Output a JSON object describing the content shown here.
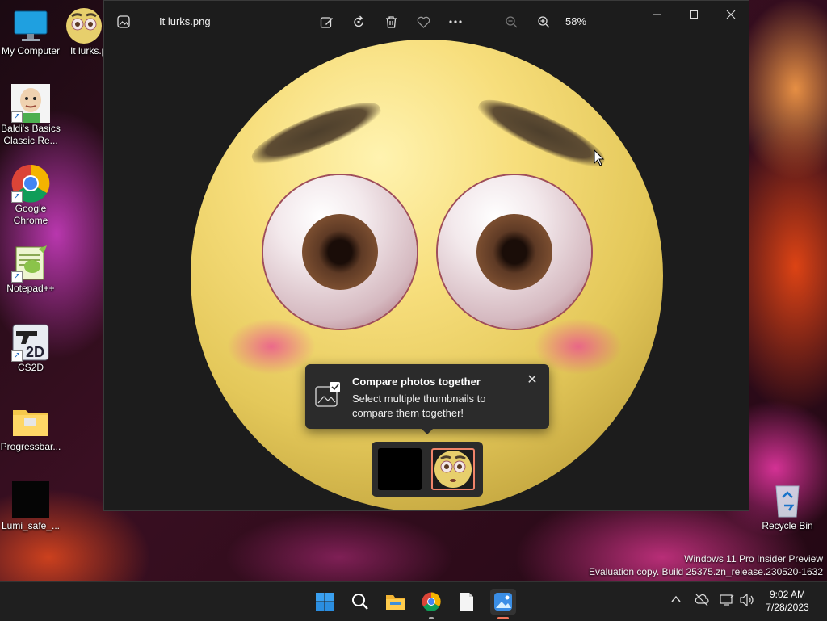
{
  "desktop": {
    "icons": [
      {
        "label": "My Computer",
        "icon": "monitor-icon"
      },
      {
        "label": "It lurks.p",
        "icon": "image-file-icon"
      },
      {
        "label": "Baldi's Basics Classic Re...",
        "icon": "baldi-app-icon"
      },
      {
        "label": "Google Chrome",
        "icon": "chrome-icon"
      },
      {
        "label": "Notepad++",
        "icon": "notepadpp-icon"
      },
      {
        "label": "CS2D",
        "icon": "cs2d-icon"
      },
      {
        "label": "Progressbar...",
        "icon": "folder-icon"
      },
      {
        "label": "Lumi_safe_...",
        "icon": "black-file-icon"
      },
      {
        "label": "Recycle Bin",
        "icon": "recycle-bin-icon"
      }
    ]
  },
  "photos_window": {
    "filename": "It lurks.png",
    "zoom": "58%",
    "toolbar": [
      "edit-image-icon",
      "rotate-icon",
      "delete-icon",
      "favorite-icon",
      "more-options-icon"
    ],
    "window_controls": [
      "minimize-icon",
      "maximize-icon",
      "close-icon"
    ],
    "toast": {
      "title": "Compare photos together",
      "body": "Select multiple thumbnails to compare them together!"
    },
    "filmstrip_selected_index": 1
  },
  "watermark": {
    "line1": "Windows 11 Pro Insider Preview",
    "line2": "Evaluation copy. Build 25375.zn_release.230520-1632"
  },
  "taskbar": {
    "apps": [
      "start-icon",
      "search-icon",
      "file-explorer-icon",
      "chrome-icon",
      "notepad-icon",
      "photos-icon"
    ],
    "active_app": "photos-icon",
    "tray": [
      "show-hidden-icons-chevron",
      "network-off-icon",
      "display-icon",
      "volume-icon"
    ],
    "time": "9:02 AM",
    "date": "7/28/2023"
  },
  "colors": {
    "accent": "#0078d4",
    "window_bg": "#1c1c1c",
    "taskbar_bg": "#1f1f1f",
    "active_indicator": "#f0745a"
  }
}
